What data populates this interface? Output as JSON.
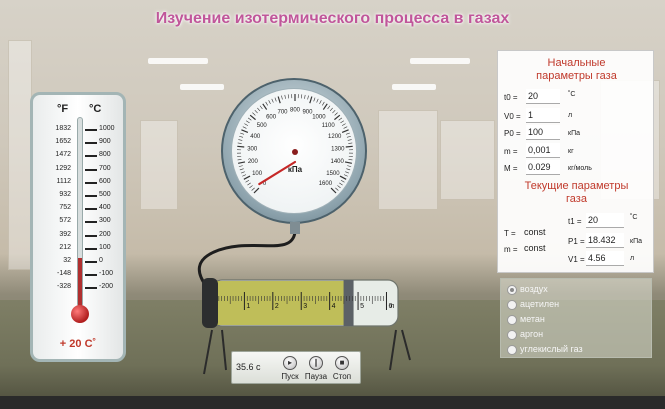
{
  "title": "Изучение изотермического процесса в газах",
  "thermometer": {
    "unit_f": "°F",
    "unit_c": "°C",
    "fahrenheit_ticks": [
      "1832",
      "1652",
      "1472",
      "1292",
      "1112",
      "932",
      "752",
      "572",
      "392",
      "212",
      "32",
      "-148",
      "-328"
    ],
    "celsius_ticks": [
      "1000",
      "900",
      "800",
      "700",
      "600",
      "500",
      "400",
      "300",
      "200",
      "100",
      "0",
      "-100",
      "-200"
    ],
    "temperature_label": "+ 20 С˚",
    "level_celsius": 20
  },
  "gauge": {
    "unit": "кПа",
    "scale_labels": [
      "0",
      "100",
      "200",
      "300",
      "400",
      "500",
      "600",
      "700",
      "800",
      "900",
      "1000",
      "1100",
      "1200",
      "1300",
      "1400",
      "1500",
      "1600"
    ],
    "value_kpa": 18.432
  },
  "cylinder": {
    "scale_labels": [
      "1",
      "2",
      "3",
      "4",
      "5",
      "6"
    ],
    "unit": "л",
    "volume_l": 4.56
  },
  "controls": {
    "timer": "35.6 с",
    "start": "Пуск",
    "pause": "Пауза",
    "stop": "Стоп"
  },
  "initial": {
    "title_line1": "Начальные",
    "title_line2": "параметры газа",
    "t0_label": "t0 =",
    "t0_value": "20",
    "t0_unit": "˚С",
    "v0_label": "V0 =",
    "v0_value": "1",
    "v0_unit": "л",
    "p0_label": "P0 =",
    "p0_value": "100",
    "p0_unit": "кПа",
    "m_label": "m =",
    "m_value": "0,001",
    "m_unit": "кг",
    "M_label": "M =",
    "M_value": "0.029",
    "M_unit": "кг/моль"
  },
  "current": {
    "title_line1": "Текущие параметры",
    "title_line2": "газа",
    "T_label": "T =",
    "T_value": "const",
    "m_label": "m =",
    "m_value": "const",
    "t1_label": "t1 =",
    "t1_value": "20",
    "t1_unit": "˚С",
    "p1_label": "P1 =",
    "p1_value": "18.432",
    "p1_unit": "кПа",
    "v1_label": "V1 =",
    "v1_value": "4.56",
    "v1_unit": "л"
  },
  "gases": {
    "selected": "воздух",
    "items": [
      "воздух",
      "ацетилен",
      "метан",
      "аргон",
      "углекислый газ"
    ]
  },
  "colors": {
    "title": "#c0569a",
    "panel_title": "#c0392b",
    "liquid": "#b7b63f"
  }
}
